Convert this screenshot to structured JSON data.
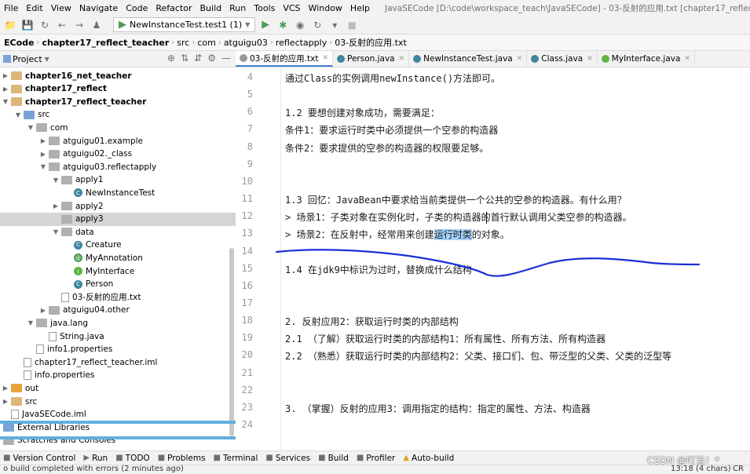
{
  "menu": [
    "File",
    "Edit",
    "View",
    "Navigate",
    "Code",
    "Refactor",
    "Build",
    "Run",
    "Tools",
    "VCS",
    "Window",
    "Help"
  ],
  "window_title": "JavaSECode [D:\\code\\workspace_teach\\JavaSECode] - 03-反射的应用.txt [chapter17_reflect_teacher]",
  "toolbar": {
    "run_config": "NewInstanceTest.test1 (1)"
  },
  "breadcrumbs": [
    "ECode",
    "chapter17_reflect_teacher",
    "src",
    "com",
    "atguigu03",
    "reflectapply",
    "03-反射的应用.txt"
  ],
  "project_panel": {
    "title": "Project"
  },
  "tree": [
    {
      "label": "chapter16_net_teacher",
      "depth": 0,
      "kind": "module",
      "arrow": "right",
      "bold": true
    },
    {
      "label": "chapter17_reflect",
      "depth": 0,
      "kind": "module",
      "arrow": "right",
      "bold": true
    },
    {
      "label": "chapter17_reflect_teacher",
      "depth": 0,
      "kind": "module",
      "arrow": "down",
      "bold": true
    },
    {
      "label": "src",
      "depth": 1,
      "kind": "src",
      "arrow": "down"
    },
    {
      "label": "com",
      "depth": 2,
      "kind": "pkg",
      "arrow": "down"
    },
    {
      "label": "atguigu01.example",
      "depth": 3,
      "kind": "pkg",
      "arrow": "right"
    },
    {
      "label": "atguigu02._class",
      "depth": 3,
      "kind": "pkg",
      "arrow": "right"
    },
    {
      "label": "atguigu03.reflectapply",
      "depth": 3,
      "kind": "pkg",
      "arrow": "down"
    },
    {
      "label": "apply1",
      "depth": 4,
      "kind": "pkg",
      "arrow": "down"
    },
    {
      "label": "NewInstanceTest",
      "depth": 5,
      "kind": "class",
      "arrow": ""
    },
    {
      "label": "apply2",
      "depth": 4,
      "kind": "pkg",
      "arrow": "right"
    },
    {
      "label": "apply3",
      "depth": 4,
      "kind": "pkg",
      "arrow": "",
      "selected": true
    },
    {
      "label": "data",
      "depth": 4,
      "kind": "pkg",
      "arrow": "down"
    },
    {
      "label": "Creature",
      "depth": 5,
      "kind": "class",
      "arrow": ""
    },
    {
      "label": "MyAnnotation",
      "depth": 5,
      "kind": "annotation",
      "arrow": ""
    },
    {
      "label": "MyInterface",
      "depth": 5,
      "kind": "interface",
      "arrow": ""
    },
    {
      "label": "Person",
      "depth": 5,
      "kind": "class",
      "arrow": ""
    },
    {
      "label": "03-反射的应用.txt",
      "depth": 4,
      "kind": "file",
      "arrow": ""
    },
    {
      "label": "atguigu04.other",
      "depth": 3,
      "kind": "pkg",
      "arrow": "right"
    },
    {
      "label": "java.lang",
      "depth": 2,
      "kind": "pkg",
      "arrow": "down"
    },
    {
      "label": "String.java",
      "depth": 3,
      "kind": "file",
      "arrow": ""
    },
    {
      "label": "info1.properties",
      "depth": 2,
      "kind": "file",
      "arrow": ""
    },
    {
      "label": "chapter17_reflect_teacher.iml",
      "depth": 1,
      "kind": "file",
      "arrow": ""
    },
    {
      "label": "info.properties",
      "depth": 1,
      "kind": "file",
      "arrow": ""
    },
    {
      "label": "out",
      "depth": 0,
      "kind": "folder-orange",
      "arrow": "right"
    },
    {
      "label": "src",
      "depth": 0,
      "kind": "folder",
      "arrow": "right"
    },
    {
      "label": "JavaSECode.iml",
      "depth": 0,
      "kind": "file",
      "arrow": ""
    },
    {
      "label": "External Libraries",
      "depth": -1,
      "kind": "lib",
      "arrow": ""
    },
    {
      "label": "Scratches and Consoles",
      "depth": -1,
      "kind": "scratch",
      "arrow": ""
    }
  ],
  "tabs": [
    {
      "label": "03-反射的应用.txt",
      "active": true,
      "color": "#9a9a9a"
    },
    {
      "label": "Person.java",
      "active": false,
      "color": "#3e86a0"
    },
    {
      "label": "NewInstanceTest.java",
      "active": false,
      "color": "#3e86a0"
    },
    {
      "label": "Class.java",
      "active": false,
      "color": "#3e86a0"
    },
    {
      "label": "MyInterface.java",
      "active": false,
      "color": "#62b543"
    }
  ],
  "editor": {
    "lines": [
      {
        "n": "4",
        "text": "通过Class的实例调用newInstance()方法即可。"
      },
      {
        "n": "5",
        "text": ""
      },
      {
        "n": "6",
        "text": "1.2 要想创建对象成功，需要满足："
      },
      {
        "n": "7",
        "text": "条件1：要求运行时类中必须提供一个空参的构造器"
      },
      {
        "n": "8",
        "text": "条件2：要求提供的空参的构造器的权限要足够。"
      },
      {
        "n": "9",
        "text": ""
      },
      {
        "n": "10",
        "text": ""
      },
      {
        "n": "11",
        "text": "1.3 回忆：JavaBean中要求给当前类提供一个公共的空参的构造器。有什么用？"
      },
      {
        "n": "12",
        "text": "> 场景1：子类对象在实例化时，子类的构造器的首行默认调用父类空参的构造器。"
      },
      {
        "n": "13",
        "text_before": "> 场景2：在反射中，经常用来创建",
        "text_hl": "运行时类",
        "text_after": "的对象。"
      },
      {
        "n": "14",
        "text": ""
      },
      {
        "n": "15",
        "text": "1.4 在jdk9中标识为过时，替换成什么结构"
      },
      {
        "n": "16",
        "text": ""
      },
      {
        "n": "17",
        "text": ""
      },
      {
        "n": "18",
        "text": "2. 反射应用2：获取运行时类的内部结构"
      },
      {
        "n": "19",
        "text": "2.1 （了解）获取运行时类的内部结构1：所有属性、所有方法、所有构造器"
      },
      {
        "n": "20",
        "text": "2.2 （熟悉）获取运行时类的内部结构2：父类、接口们、包、带泛型的父类、父类的泛型等"
      },
      {
        "n": "21",
        "text": ""
      },
      {
        "n": "22",
        "text": ""
      },
      {
        "n": "23",
        "text": "3. （掌握）反射的应用3：调用指定的结构：指定的属性、方法、构造器"
      },
      {
        "n": "24",
        "text": ""
      }
    ]
  },
  "bottom_tools": [
    {
      "label": "Version Control",
      "icon": "branch-icon"
    },
    {
      "label": "Run",
      "icon": "run-icon"
    },
    {
      "label": "TODO",
      "icon": "todo-icon"
    },
    {
      "label": "Problems",
      "icon": "problems-icon"
    },
    {
      "label": "Terminal",
      "icon": "terminal-icon"
    },
    {
      "label": "Services",
      "icon": "services-icon"
    },
    {
      "label": "Build",
      "icon": "hammer-icon"
    },
    {
      "label": "Profiler",
      "icon": "profiler-icon"
    },
    {
      "label": "Auto-build",
      "icon": "warning-icon"
    }
  ],
  "status": {
    "message": "o build completed with errors (2 minutes ago)",
    "position": "13:18 (4 chars)",
    "line_sep": "CR"
  },
  "watermark": "CSDN @叮当！*"
}
